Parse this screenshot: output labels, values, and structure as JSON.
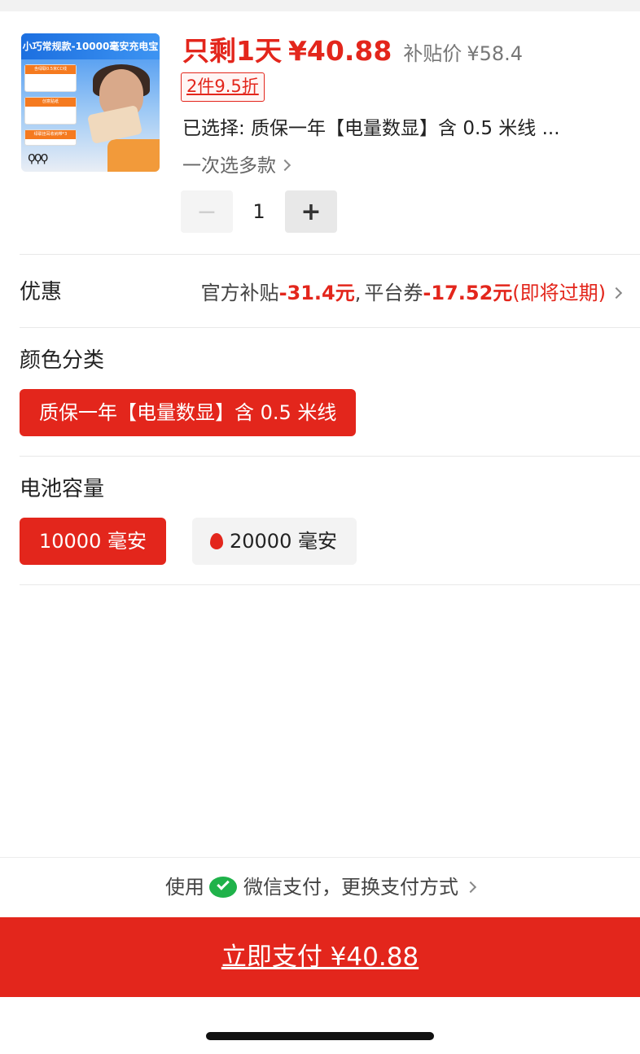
{
  "product": {
    "thumb_title": "小巧常规款-10000毫安充电宝",
    "thumb_tag_1": "含绿联0.5米CC线",
    "thumb_tag_2": "创意贴纸",
    "thumb_tag_3": "绿联挂耳收纳带*3",
    "urgency": "只剩1天",
    "price": "¥40.88",
    "subsidy_label": "补贴价",
    "subsidy_price": "¥58.4",
    "discount_tag": "2件9.5折",
    "selected": "已选择: 质保一年【电量数显】含 0.5 米线 ...",
    "multi_select": "一次选多款"
  },
  "quantity": {
    "minus": "−",
    "value": "1",
    "plus": "+"
  },
  "offers": {
    "label": "优惠",
    "official_label": "官方补贴",
    "official_amount": "-31.4元",
    "sep": ",",
    "platform_label": "平台券",
    "platform_amount": "-17.52元",
    "platform_note": "(即将过期)"
  },
  "color": {
    "title": "颜色分类",
    "options": [
      {
        "label": "质保一年【电量数显】含 0.5 米线",
        "selected": true
      }
    ]
  },
  "capacity": {
    "title": "电池容量",
    "options": [
      {
        "label": "10000 毫安",
        "selected": true
      },
      {
        "label": "20000 毫安",
        "selected": false,
        "hot": true
      }
    ]
  },
  "payment": {
    "prefix": "使用",
    "method": "微信支付，更换支付方式",
    "pay_button": "立即支付 ¥40.88"
  },
  "colors": {
    "accent": "#e3261c",
    "wechat": "#1fb24a"
  }
}
